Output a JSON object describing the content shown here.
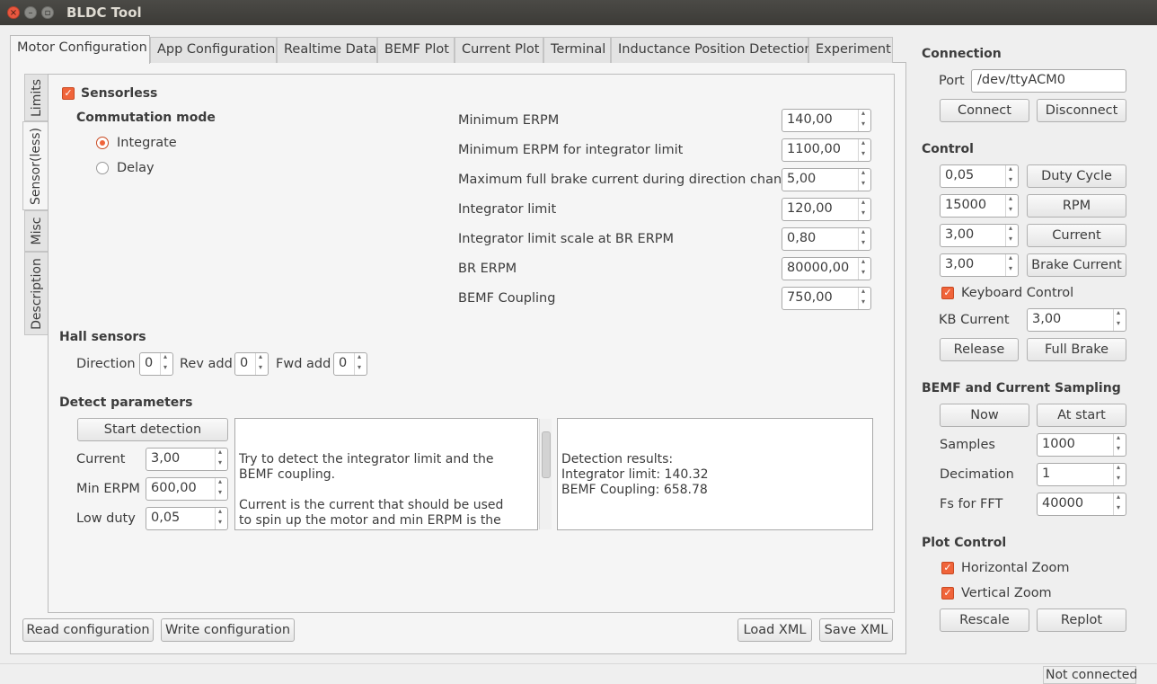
{
  "window": {
    "title": "BLDC Tool",
    "close_glyph": "×",
    "min_glyph": "–",
    "max_glyph": "▫"
  },
  "tabs": [
    {
      "label": "Motor Configuration"
    },
    {
      "label": "App Configuration"
    },
    {
      "label": "Realtime Data"
    },
    {
      "label": "BEMF Plot"
    },
    {
      "label": "Current Plot"
    },
    {
      "label": "Terminal"
    },
    {
      "label": "Inductance Position Detection"
    },
    {
      "label": "Experiment"
    }
  ],
  "side_tabs": [
    {
      "label": "Limits"
    },
    {
      "label": "Sensor(less)"
    },
    {
      "label": "Misc"
    },
    {
      "label": "Description"
    }
  ],
  "sensorless": {
    "checkbox_label": "Sensorless",
    "check_mark": "✓",
    "commutation_title": "Commutation mode",
    "integrate_label": "Integrate",
    "delay_label": "Delay"
  },
  "params": [
    {
      "label": "Minimum ERPM",
      "value": "140,00"
    },
    {
      "label": "Minimum ERPM for integrator limit",
      "value": "1100,00"
    },
    {
      "label": "Maximum full brake current during direction change",
      "value": "5,00"
    },
    {
      "label": "Integrator limit",
      "value": "120,00"
    },
    {
      "label": "Integrator limit scale at BR ERPM",
      "value": "0,80"
    },
    {
      "label": "BR ERPM",
      "value": "80000,00"
    },
    {
      "label": "BEMF Coupling",
      "value": "750,00"
    }
  ],
  "hall": {
    "title": "Hall sensors",
    "direction_label": "Direction",
    "direction_value": "0",
    "rev_label": "Rev add",
    "rev_value": "0",
    "fwd_label": "Fwd add",
    "fwd_value": "0"
  },
  "detect": {
    "title": "Detect parameters",
    "start_button": "Start detection",
    "current_label": "Current",
    "current_value": "3,00",
    "min_erpm_label": "Min ERPM",
    "min_erpm_value": "600,00",
    "low_duty_label": "Low duty",
    "low_duty_value": "0,05",
    "help_text": "Try to detect the integrator limit and the BEMF coupling.\n\nCurrent is the current that should be used to spin up the motor and min ERPM is the ERPM below which auto-commutation should happen. Adjust them until the motor is able to spin up",
    "results_text": "Detection results:\nIntegrator limit: 140.32\nBEMF Coupling: 658.78"
  },
  "bottom_buttons": {
    "read": "Read configuration",
    "write": "Write configuration",
    "load_xml": "Load XML",
    "save_xml": "Save XML"
  },
  "connection": {
    "title": "Connection",
    "port_label": "Port",
    "port_value": "/dev/ttyACM0",
    "connect": "Connect",
    "disconnect": "Disconnect"
  },
  "control": {
    "title": "Control",
    "duty_value": "0,05",
    "duty_button": "Duty Cycle",
    "rpm_value": "15000",
    "rpm_button": "RPM",
    "current_value": "3,00",
    "current_button": "Current",
    "brake_value": "3,00",
    "brake_button": "Brake Current",
    "keyboard_label": "Keyboard Control",
    "kb_current_label": "KB Current",
    "kb_current_value": "3,00",
    "release": "Release",
    "full_brake": "Full Brake"
  },
  "sampling": {
    "title": "BEMF and Current Sampling",
    "now": "Now",
    "at_start": "At start",
    "samples_label": "Samples",
    "samples_value": "1000",
    "decimation_label": "Decimation",
    "decimation_value": "1",
    "fs_label": "Fs for FFT",
    "fs_value": "40000"
  },
  "plot_control": {
    "title": "Plot Control",
    "hzoom": "Horizontal Zoom",
    "vzoom": "Vertical Zoom",
    "rescale": "Rescale",
    "replot": "Replot"
  },
  "status": {
    "text": "Not connected"
  },
  "colors": {
    "accent": "#f0643a",
    "titlebar": "#3c3b37"
  }
}
